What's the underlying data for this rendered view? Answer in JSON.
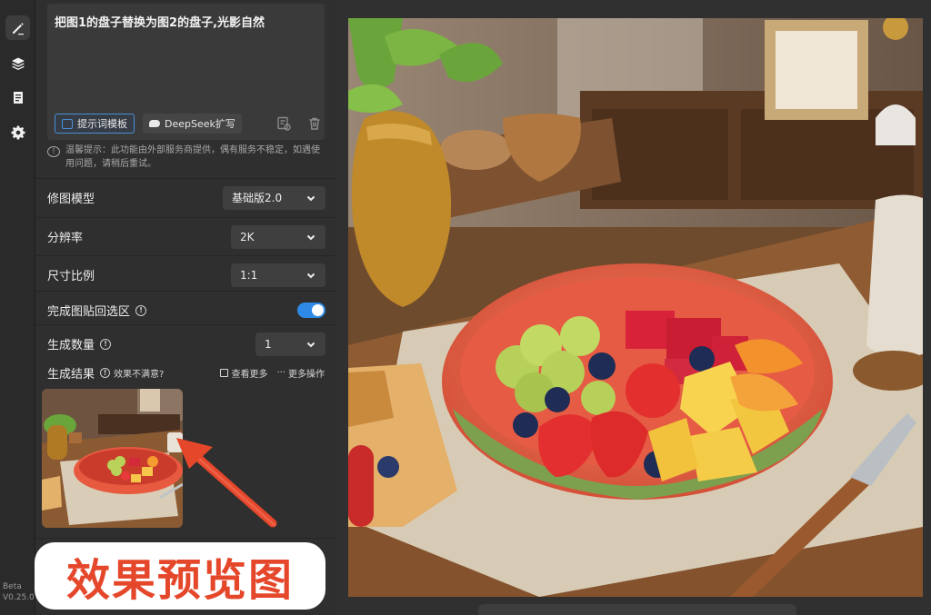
{
  "rail": {
    "items": [
      {
        "icon": "edit-icon",
        "active": true
      },
      {
        "icon": "layers-icon",
        "active": false
      },
      {
        "icon": "clipboard-icon",
        "active": false
      },
      {
        "icon": "gear-icon",
        "active": false
      }
    ],
    "version_beta": "Beta",
    "version_number": "V0.25.0"
  },
  "prompt": {
    "text": "把图1的盘子替换为图2的盘子,光影自然",
    "template_label": "提示词模板",
    "deepseek_label": "DeepSeek扩写"
  },
  "notice": "温馨提示：此功能由外部服务商提供，偶有服务不稳定，如遇使用问题，请稍后重试。",
  "settings": {
    "model_label": "修图模型",
    "model_value": "基础版2.0",
    "resolution_label": "分辨率",
    "resolution_value": "2K",
    "ratio_label": "尺寸比例",
    "ratio_value": "1:1",
    "paste_back_label": "完成图贴回选区",
    "paste_back_on": true,
    "count_label": "生成数量",
    "count_value": "1"
  },
  "result": {
    "label": "生成结果",
    "unsatisfied": "效果不满意?",
    "view_more": "查看更多",
    "more_actions": "更多操作"
  },
  "annotation": {
    "callout_text": "效果预览图",
    "color": "#e5472b"
  }
}
